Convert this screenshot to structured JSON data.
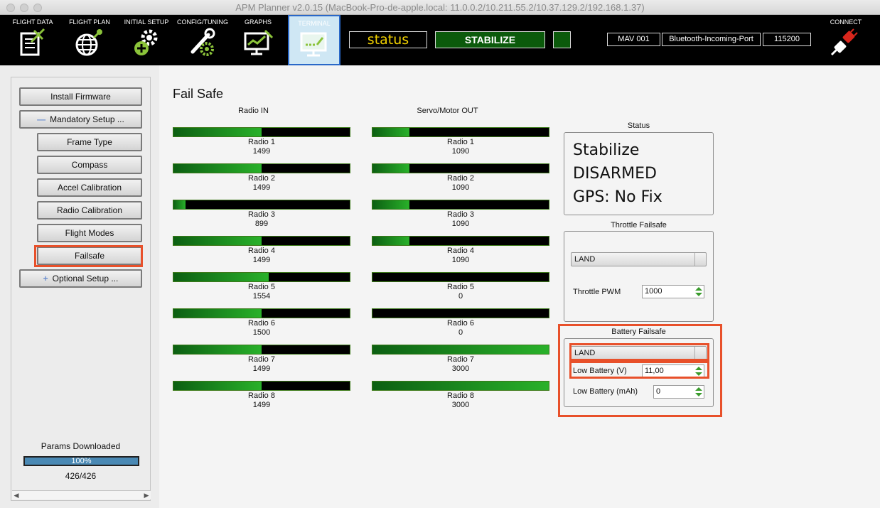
{
  "window": {
    "title": "APM Planner v2.0.15 (MacBook-Pro-de-apple.local: 11.0.0.2/10.211.55.2/10.37.129.2/192.168.1.37)"
  },
  "toolbar": {
    "flight_data": "FLIGHT DATA",
    "flight_plan": "FLIGHT PLAN",
    "initial_setup": "INITIAL SETUP",
    "config_tuning": "CONFIG/TUNING",
    "graphs": "GRAPHS",
    "terminal": "TERMINAL",
    "status": "status",
    "mode": "STABILIZE",
    "mav": "MAV 001",
    "port": "Bluetooth-Incoming-Port",
    "baud": "115200",
    "connect": "CONNECT"
  },
  "sidebar": {
    "install_firmware": "Install Firmware",
    "mandatory_setup": "Mandatory Setup ...",
    "frame_type": "Frame Type",
    "compass": "Compass",
    "accel_calibration": "Accel Calibration",
    "radio_calibration": "Radio Calibration",
    "flight_modes": "Flight Modes",
    "failsafe": "Failsafe",
    "optional_setup": "Optional Setup ...",
    "params_title": "Params Downloaded",
    "progress_text": "100%",
    "progress_value": 1.0,
    "params_count": "426/426"
  },
  "main": {
    "title": "Fail Safe",
    "radio_in_title": "Radio IN",
    "servo_out_title": "Servo/Motor OUT",
    "radio_in": [
      {
        "label": "Radio 1",
        "value": "1499",
        "fill": 0.5
      },
      {
        "label": "Radio 2",
        "value": "1499",
        "fill": 0.5
      },
      {
        "label": "Radio 3",
        "value": "899",
        "fill": 0.07
      },
      {
        "label": "Radio 4",
        "value": "1499",
        "fill": 0.5
      },
      {
        "label": "Radio 5",
        "value": "1554",
        "fill": 0.54
      },
      {
        "label": "Radio 6",
        "value": "1500",
        "fill": 0.5
      },
      {
        "label": "Radio 7",
        "value": "1499",
        "fill": 0.5
      },
      {
        "label": "Radio 8",
        "value": "1499",
        "fill": 0.5
      }
    ],
    "servo_out": [
      {
        "label": "Radio 1",
        "value": "1090",
        "fill": 0.21
      },
      {
        "label": "Radio 2",
        "value": "1090",
        "fill": 0.21
      },
      {
        "label": "Radio 3",
        "value": "1090",
        "fill": 0.21
      },
      {
        "label": "Radio 4",
        "value": "1090",
        "fill": 0.21
      },
      {
        "label": "Radio 5",
        "value": "0",
        "fill": 0
      },
      {
        "label": "Radio 6",
        "value": "0",
        "fill": 0
      },
      {
        "label": "Radio 7",
        "value": "3000",
        "fill": 1.0
      },
      {
        "label": "Radio 8",
        "value": "3000",
        "fill": 1.0
      }
    ],
    "status": {
      "title": "Status",
      "mode": "Stabilize",
      "arm_state": "DISARMED",
      "gps": "GPS: No Fix"
    },
    "throttle_failsafe": {
      "title": "Throttle Failsafe",
      "action": "LAND",
      "pwm_label": "Throttle PWM",
      "pwm_value": "1000"
    },
    "battery_failsafe": {
      "title": "Battery Failsafe",
      "action": "LAND",
      "low_battery_v_label": "Low Battery (V)",
      "low_battery_v_value": "11,00",
      "low_battery_mah_label": "Low Battery (mAh)",
      "low_battery_mah_value": "0"
    }
  },
  "colors": {
    "highlight": "#e8502a",
    "bar_green": "#29b12a",
    "mode_green": "#0b5a0b",
    "status_yellow": "#f0d000"
  }
}
